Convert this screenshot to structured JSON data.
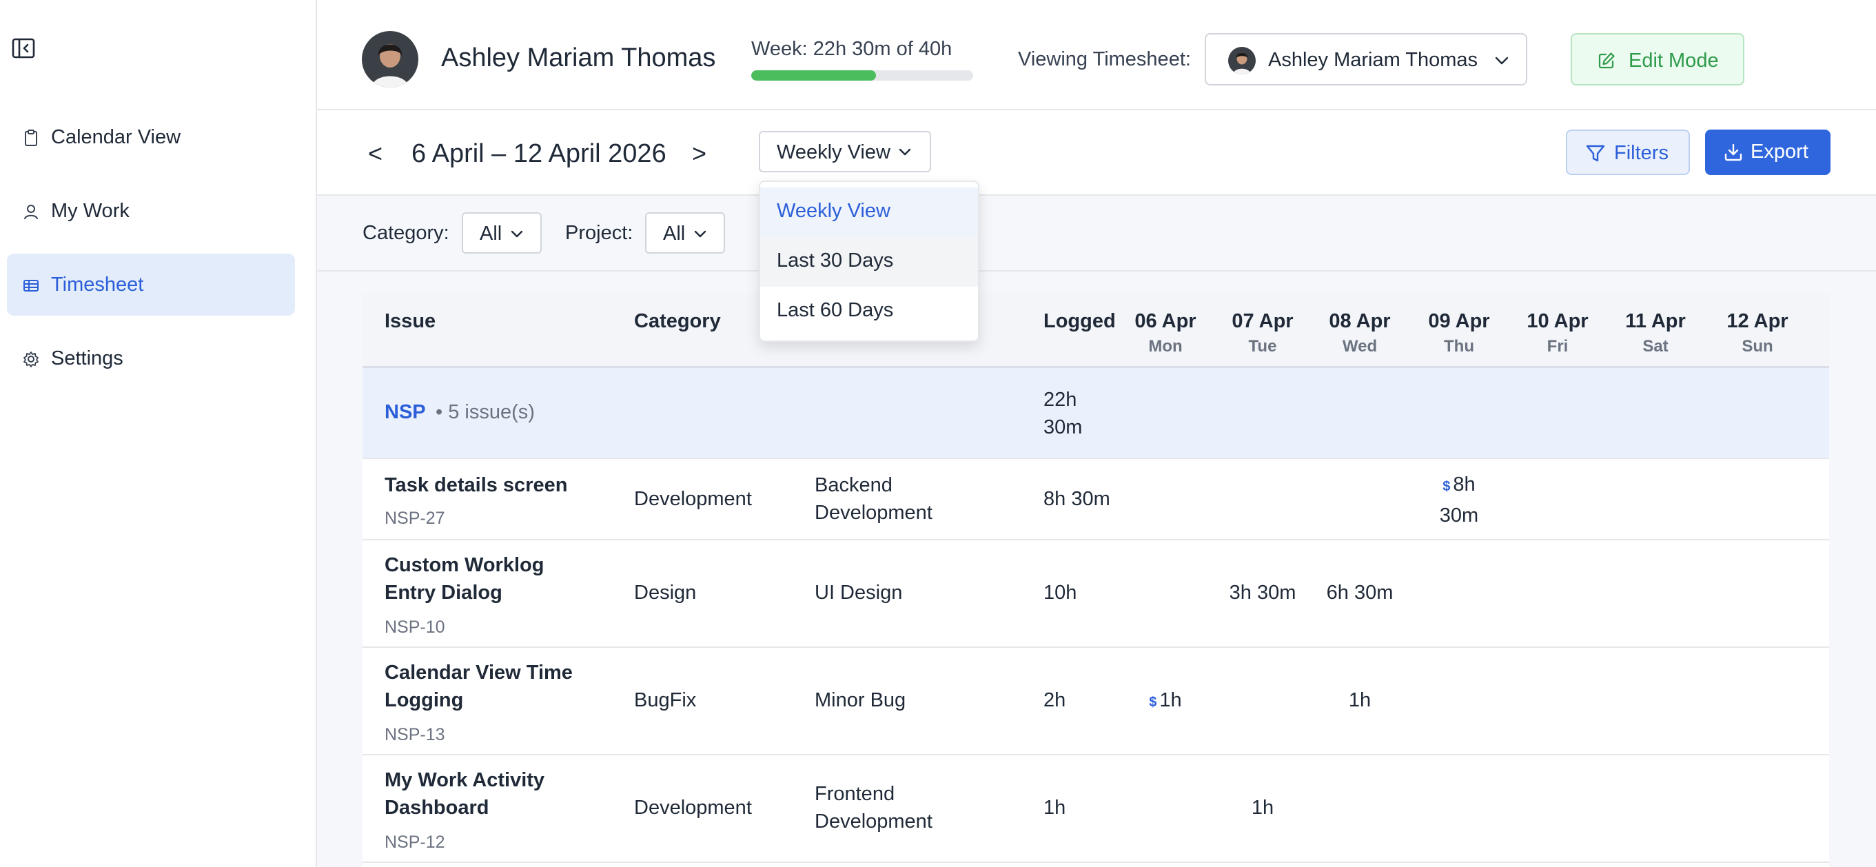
{
  "sidebar": {
    "items": [
      {
        "label": "Calendar View",
        "icon": "clipboard-icon"
      },
      {
        "label": "My Work",
        "icon": "user-icon"
      },
      {
        "label": "Timesheet",
        "icon": "table-icon"
      },
      {
        "label": "Settings",
        "icon": "gear-icon"
      }
    ],
    "active_index": 2
  },
  "header": {
    "user_name": "Ashley Mariam Thomas",
    "week_label": "Week: 22h 30m of 40h",
    "week_progress": 0.5625,
    "viewing_label": "Viewing Timesheet:",
    "viewing_user": "Ashley Mariam Thomas",
    "edit_mode_label": "Edit Mode"
  },
  "toolbar": {
    "prev": "<",
    "next": ">",
    "date_range": "6 April – 12 April 2026",
    "view_selected": "Weekly View",
    "filters_label": "Filters",
    "export_label": "Export"
  },
  "view_dropdown": {
    "options": [
      "Weekly View",
      "Last 30 Days",
      "Last 60 Days"
    ],
    "selected_index": 0,
    "hover_index": 1
  },
  "filters": {
    "category_label": "Category:",
    "category_value": "All",
    "project_label": "Project:",
    "project_value": "All"
  },
  "table": {
    "columns": {
      "issue": "Issue",
      "category": "Category",
      "logged": "Logged"
    },
    "days": [
      {
        "date": "06 Apr",
        "weekday": "Mon"
      },
      {
        "date": "07 Apr",
        "weekday": "Tue"
      },
      {
        "date": "08 Apr",
        "weekday": "Wed"
      },
      {
        "date": "09 Apr",
        "weekday": "Thu"
      },
      {
        "date": "10 Apr",
        "weekday": "Fri"
      },
      {
        "date": "11 Apr",
        "weekday": "Sat"
      },
      {
        "date": "12 Apr",
        "weekday": "Sun"
      }
    ],
    "group": {
      "name": "NSP",
      "count": "• 5 issue(s)",
      "logged": "22h 30m"
    },
    "rows": [
      {
        "title": "Task details screen",
        "key": "NSP-27",
        "category": "Development",
        "subcategory": "Backend Development",
        "logged": "8h 30m",
        "days": [
          "",
          "",
          "",
          "8h 30m",
          "",
          "",
          ""
        ],
        "billable_days": [
          3
        ]
      },
      {
        "title": "Custom Worklog Entry Dialog",
        "key": "NSP-10",
        "category": "Design",
        "subcategory": "UI Design",
        "logged": "10h",
        "days": [
          "",
          "3h 30m",
          "6h 30m",
          "",
          "",
          "",
          ""
        ],
        "billable_days": []
      },
      {
        "title": "Calendar View Time Logging",
        "key": "NSP-13",
        "category": "BugFix",
        "subcategory": "Minor Bug",
        "logged": "2h",
        "days": [
          "1h",
          "",
          "1h",
          "",
          "",
          "",
          ""
        ],
        "billable_days": [
          0
        ]
      },
      {
        "title": "My Work Activity Dashboard",
        "key": "NSP-12",
        "category": "Development",
        "subcategory": "Frontend Development",
        "logged": "1h",
        "days": [
          "",
          "1h",
          "",
          "",
          "",
          "",
          ""
        ],
        "billable_days": []
      }
    ],
    "billable_marker": "$"
  },
  "colors": {
    "accent": "#2f66dd",
    "active_nav_bg": "#e3ecfb",
    "progress": "#4cbd5d",
    "edit_mode": "#2e9b4a"
  }
}
